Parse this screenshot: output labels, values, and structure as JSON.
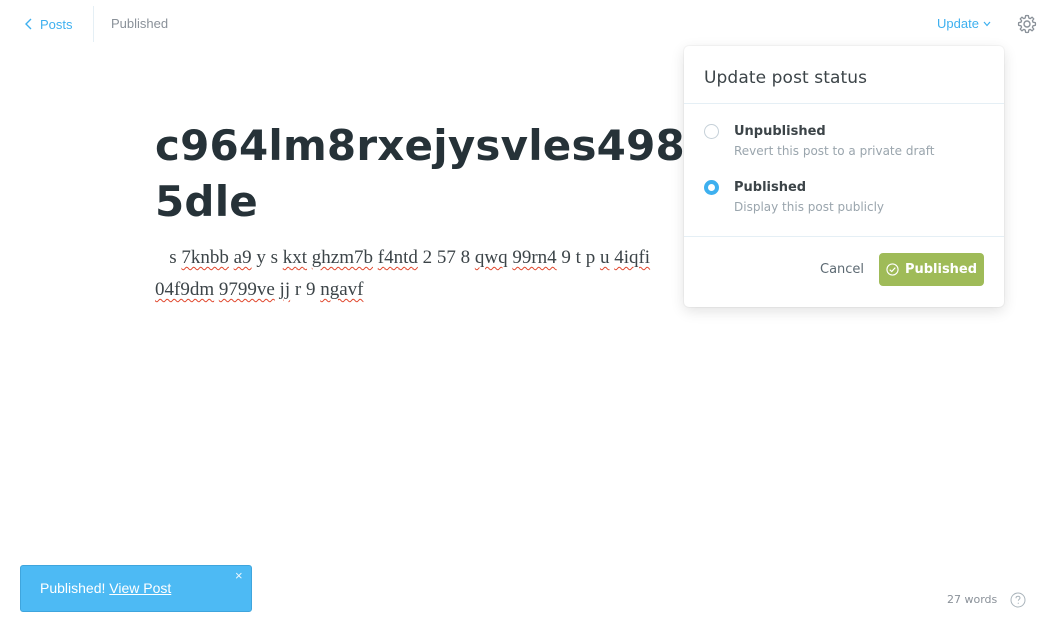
{
  "topbar": {
    "back_label": "Posts",
    "status": "Published",
    "update_label": "Update"
  },
  "post": {
    "title": "c964lm8rxejysvles4985dle",
    "body_words": [
      {
        "t": "s",
        "err": false
      },
      {
        "t": "7knbb",
        "err": true
      },
      {
        "t": "a9",
        "err": true
      },
      {
        "t": "y",
        "err": false
      },
      {
        "t": "s",
        "err": false
      },
      {
        "t": "kxt",
        "err": true
      },
      {
        "t": "ghzm7b",
        "err": true
      },
      {
        "t": "f4ntd",
        "err": true
      },
      {
        "t": "2",
        "err": false
      },
      {
        "t": "57",
        "err": false
      },
      {
        "t": "8",
        "err": false
      },
      {
        "t": "qwq",
        "err": true
      },
      {
        "t": "99rn4",
        "err": true
      },
      {
        "t": "9",
        "err": false
      },
      {
        "t": "t",
        "err": false
      },
      {
        "t": "p",
        "err": false
      },
      {
        "t": "u",
        "err": true
      },
      {
        "t": "4iqfi",
        "err": true
      },
      {
        "t": "04f9dm",
        "err": true
      },
      {
        "t": "9799ve",
        "err": true
      },
      {
        "t": "jj",
        "err": true
      },
      {
        "t": "r",
        "err": false
      },
      {
        "t": "9",
        "err": false
      },
      {
        "t": "ngavf",
        "err": true
      }
    ]
  },
  "popover": {
    "title": "Update post status",
    "options": [
      {
        "label": "Unpublished",
        "description": "Revert this post to a private draft",
        "checked": false
      },
      {
        "label": "Published",
        "description": "Display this post publicly",
        "checked": true
      }
    ],
    "cancel_label": "Cancel",
    "confirm_label": "Published"
  },
  "toast": {
    "message": "Published!",
    "link_label": "View Post",
    "close_glyph": "×"
  },
  "footer": {
    "word_count": "27 words"
  },
  "colors": {
    "accent": "#3eb0ef",
    "success": "#9fbb58",
    "toast_bg": "#4dbaf4"
  },
  "icons": {
    "back": "chevron-left-icon",
    "update_caret": "chevron-down-icon",
    "settings": "gear-icon",
    "confirm": "check-circle-icon",
    "help": "question-circle-icon"
  }
}
